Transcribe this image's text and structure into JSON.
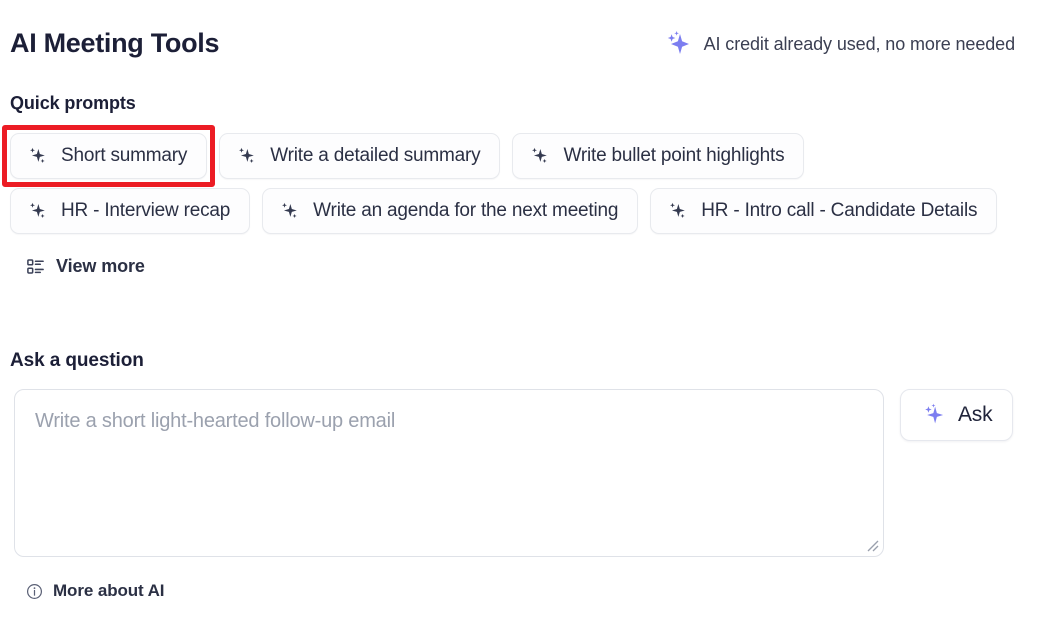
{
  "header": {
    "title": "AI Meeting Tools",
    "credit_note": "AI credit already used, no more needed",
    "credit_icon": "sparkle-icon"
  },
  "quick_prompts": {
    "heading": "Quick prompts",
    "items": [
      {
        "label": "Short summary",
        "icon": "sparkle-icon",
        "highlighted": true
      },
      {
        "label": "Write a detailed summary",
        "icon": "sparkle-icon",
        "highlighted": false
      },
      {
        "label": "Write bullet point highlights",
        "icon": "sparkle-icon",
        "highlighted": false
      },
      {
        "label": "HR - Interview recap",
        "icon": "sparkle-icon",
        "highlighted": false
      },
      {
        "label": "Write an agenda for the next meeting",
        "icon": "sparkle-icon",
        "highlighted": false
      },
      {
        "label": "HR - Intro call - Candidate Details",
        "icon": "sparkle-icon",
        "highlighted": false
      }
    ],
    "view_more_label": "View more",
    "view_more_icon": "list-view-icon"
  },
  "ask": {
    "heading": "Ask a question",
    "placeholder": "Write a short light-hearted follow-up email",
    "value": "",
    "button_label": "Ask",
    "button_icon": "sparkle-icon",
    "resize_handle": "resize-grip"
  },
  "footer": {
    "more_about_label": "More about AI",
    "more_about_icon": "info-circle-icon"
  },
  "colors": {
    "accent_purple": "#7c7ef0",
    "highlight_red": "#ec1c24",
    "text_dark": "#1c1f37",
    "text_muted": "#9ba1ae",
    "border": "#e8eaee",
    "background": "#ffffff"
  }
}
